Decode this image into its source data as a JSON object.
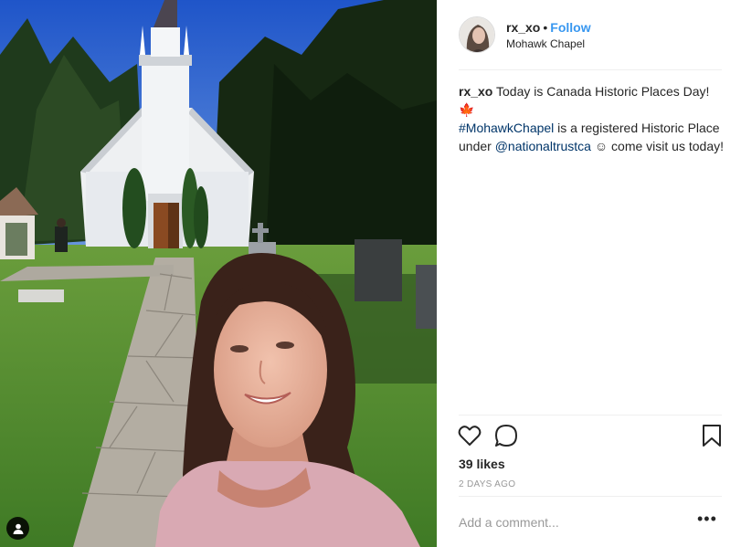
{
  "post": {
    "username": "rx_xo",
    "separator": "•",
    "follow_label": "Follow",
    "location": "Mohawk Chapel",
    "caption": {
      "username": "rx_xo",
      "text1": " Today is Canada Historic Places Day! ",
      "maple_emoji": "🍁",
      "hashtag": "#MohawkChapel",
      "text2": " is a registered Historic Place under ",
      "mention": "@nationaltrustca",
      "text3": " ☺ come visit us today!"
    },
    "likes": "39 likes",
    "time_ago": "2 DAYS AGO",
    "comment_placeholder": "Add a comment...",
    "more_options": "•••"
  },
  "icons": {
    "like": "heart-outline-icon",
    "comment": "speech-bubble-icon",
    "save": "bookmark-icon",
    "tagged_people": "person-tag-icon"
  },
  "colors": {
    "link_blue": "#3897f0",
    "hashtag": "#003569",
    "muted": "#999999",
    "divider": "#efefef"
  }
}
